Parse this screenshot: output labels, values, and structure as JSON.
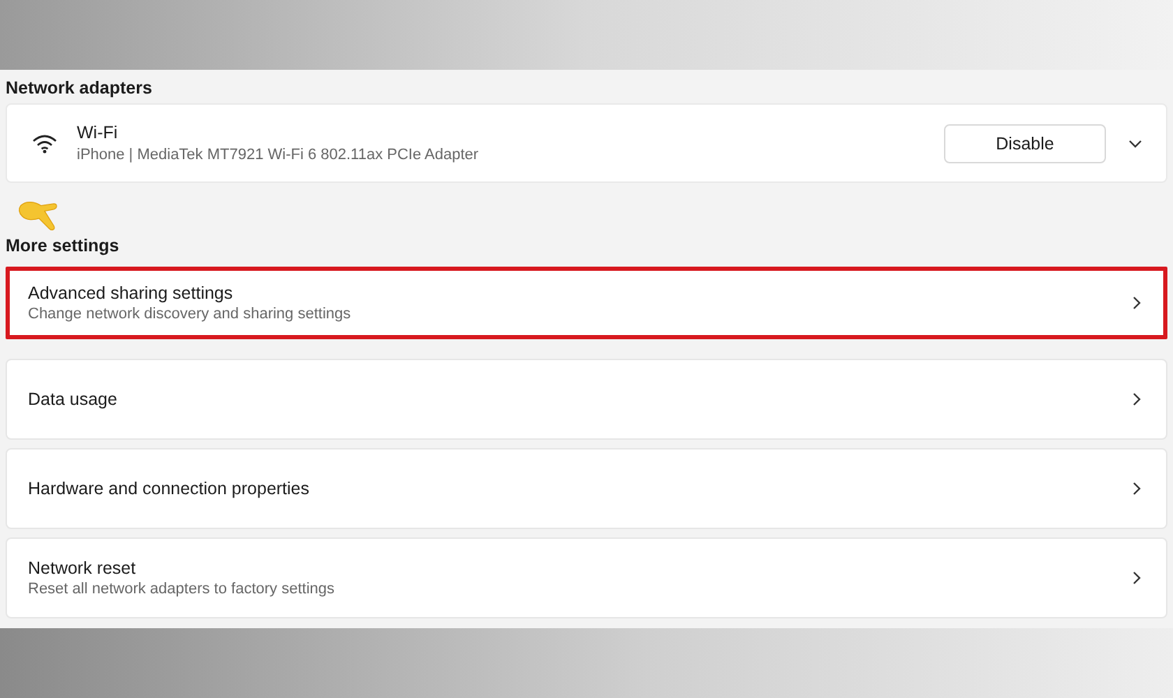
{
  "network_adapters": {
    "heading": "Network adapters",
    "adapters": [
      {
        "name": "Wi-Fi",
        "description": "iPhone | MediaTek MT7921 Wi-Fi 6 802.11ax PCIe Adapter",
        "button": "Disable",
        "expanded": false
      }
    ]
  },
  "more_settings": {
    "heading": "More settings",
    "items": [
      {
        "title": "Advanced sharing settings",
        "subtitle": "Change network discovery and sharing settings",
        "highlighted": true
      },
      {
        "title": "Data usage",
        "highlighted": false
      },
      {
        "title": "Hardware and connection properties",
        "highlighted": false
      },
      {
        "title": "Network reset",
        "subtitle": "Reset all network adapters to factory settings",
        "highlighted": false
      }
    ]
  }
}
